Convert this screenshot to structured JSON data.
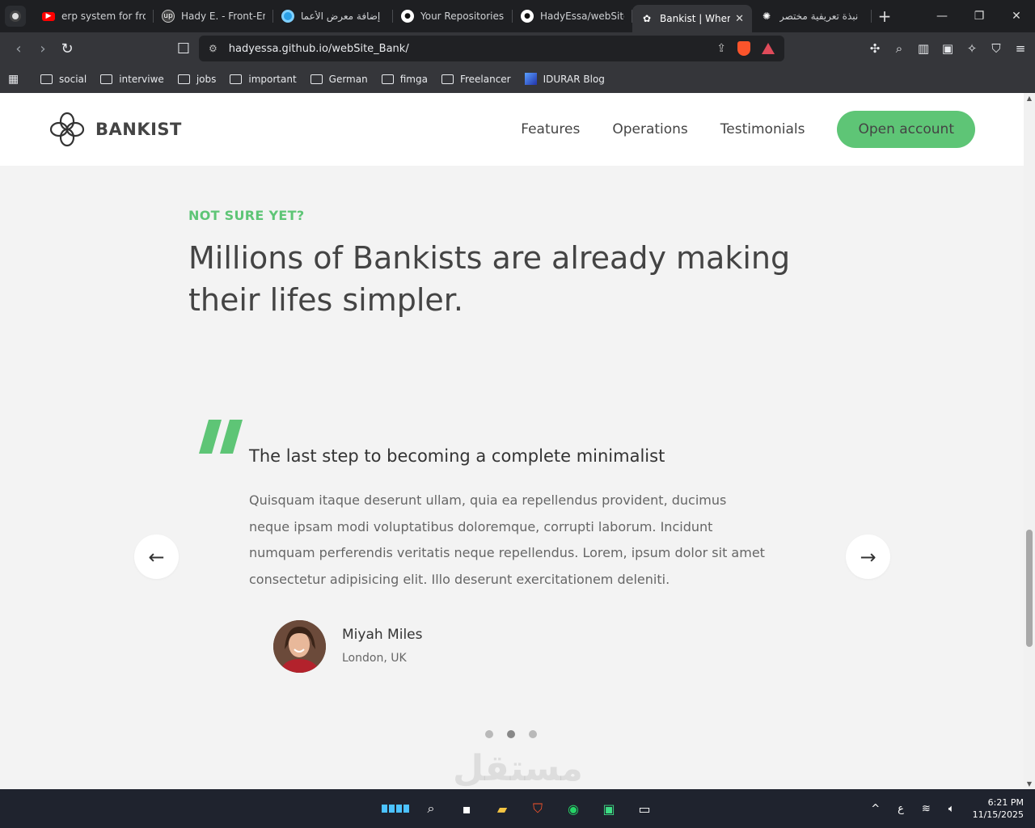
{
  "browser": {
    "tabs": [
      {
        "title": "erp system for fron",
        "icon": "youtube-icon",
        "color": "#ff0000"
      },
      {
        "title": "Hady E. - Front-En",
        "icon": "upwork-icon",
        "color": "#444444"
      },
      {
        "title": "إضافة معرض الأعما",
        "icon": "mostaql-icon",
        "color": "#2aa0e6"
      },
      {
        "title": "Your Repositories",
        "icon": "github-icon",
        "color": "#ffffff"
      },
      {
        "title": "HadyEssa/webSite",
        "icon": "github-icon",
        "color": "#ffffff"
      },
      {
        "title": "Bankist | Wher",
        "icon": "bankist-icon",
        "color": "#ffffff",
        "active": true
      },
      {
        "title": "نبذة تعريفية مختصر",
        "icon": "chatgpt-icon",
        "color": "#ffffff"
      }
    ],
    "url": "hadyessa.github.io/webSite_Bank/",
    "bookmarks": [
      "social",
      "interviwe",
      "jobs",
      "important",
      "German",
      "fimga",
      "Freelancer",
      "IDURAR Blog"
    ]
  },
  "site": {
    "logo_text": "BANKIST",
    "nav": {
      "features": "Features",
      "operations": "Operations",
      "testimonials": "Testimonials",
      "open_account": "Open account"
    },
    "section": {
      "eyebrow": "NOT SURE YET?",
      "title": "Millions of Bankists are already making their lifes simpler."
    },
    "testimonial": {
      "heading": "The last step to becoming a complete minimalist",
      "body": "Quisquam itaque deserunt ullam, quia ea repellendus provident, ducimus neque ipsam modi voluptatibus doloremque, corrupti laborum. Incidunt numquam perferendis veritatis neque repellendus. Lorem, ipsum dolor sit amet consectetur adipisicing elit. Illo deserunt exercitationem deleniti.",
      "name": "Miyah Miles",
      "location": "London, UK"
    },
    "slider": {
      "prev": "←",
      "next": "→",
      "dots": 3,
      "active_dot": 2
    },
    "watermark": "مستقل",
    "colors": {
      "accent": "#5ec576",
      "text": "#444444"
    }
  },
  "taskbar": {
    "time": "6:21 PM",
    "date": "11/15/2025",
    "lang": "ع"
  }
}
